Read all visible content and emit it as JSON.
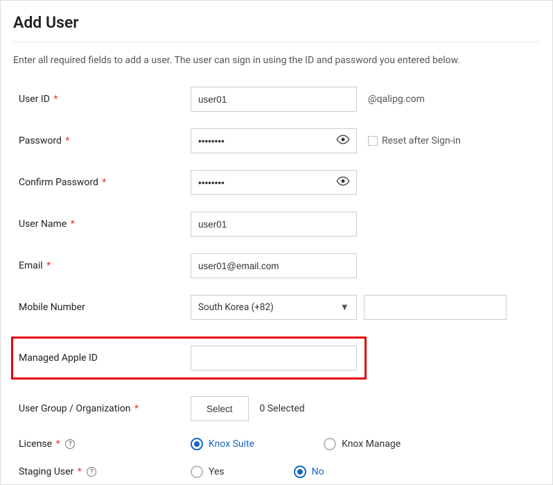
{
  "title": "Add User",
  "intro": "Enter all required fields to add a user. The user can sign in using the ID and password you entered below.",
  "labels": {
    "user_id": "User ID",
    "password": "Password",
    "confirm_password": "Confirm Password",
    "user_name": "User Name",
    "email": "Email",
    "mobile": "Mobile Number",
    "managed_apple_id": "Managed Apple ID",
    "user_group": "User Group / Organization",
    "license": "License",
    "staging_user": "Staging User"
  },
  "values": {
    "user_id": "user01",
    "password": "••••••••",
    "confirm_password": "••••••••",
    "user_name": "user01",
    "email": "user01@email.com",
    "mobile_code": "South Korea (+82)",
    "managed_apple_id": ""
  },
  "user_id_suffix": "@qalipg.com",
  "reset_checkbox_label": "Reset after Sign-in",
  "select_button": "Select",
  "selected_count": "0 Selected",
  "license_options": {
    "knox_suite": "Knox Suite",
    "knox_manage": "Knox Manage"
  },
  "staging_options": {
    "yes": "Yes",
    "no": "No"
  },
  "required_marker": "*"
}
